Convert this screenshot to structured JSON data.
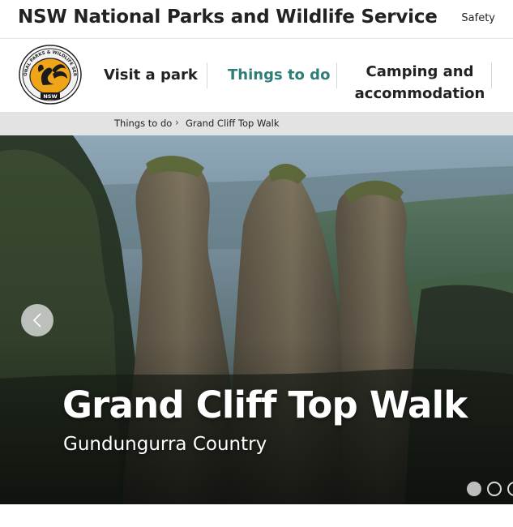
{
  "header": {
    "site_title": "NSW National Parks and Wildlife Service",
    "safety_label": "Safety"
  },
  "logo": {
    "ring_text": "NATIONAL PARKS & WILDLIFE SERVICE",
    "badge_text": "NSW"
  },
  "nav": {
    "items": [
      {
        "label": "Visit a park"
      },
      {
        "label": "Things to do",
        "active": true
      },
      {
        "label": "Camping and accommodation"
      }
    ],
    "active_color": "#2e7d78"
  },
  "breadcrumb": {
    "items": [
      "Things to do",
      "Grand Cliff Top Walk"
    ],
    "separator": "›"
  },
  "hero": {
    "title": "Grand Cliff Top Walk",
    "subtitle": "Gundungurra Country",
    "prev_icon": "chevron-left-icon",
    "slide_count": 3,
    "active_slide": 1
  }
}
